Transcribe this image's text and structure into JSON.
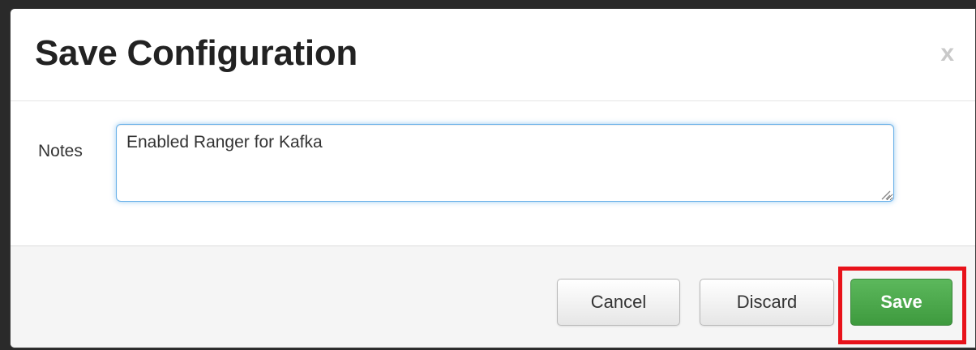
{
  "dialog": {
    "title": "Save Configuration",
    "close_label": "x"
  },
  "notes": {
    "label": "Notes",
    "value": "Enabled Ranger for Kafka"
  },
  "footer": {
    "cancel_label": "Cancel",
    "discard_label": "Discard",
    "save_label": "Save"
  },
  "colors": {
    "save_button": "#4cae4c",
    "highlight": "#e8121a",
    "focus_border": "#66afe9"
  }
}
